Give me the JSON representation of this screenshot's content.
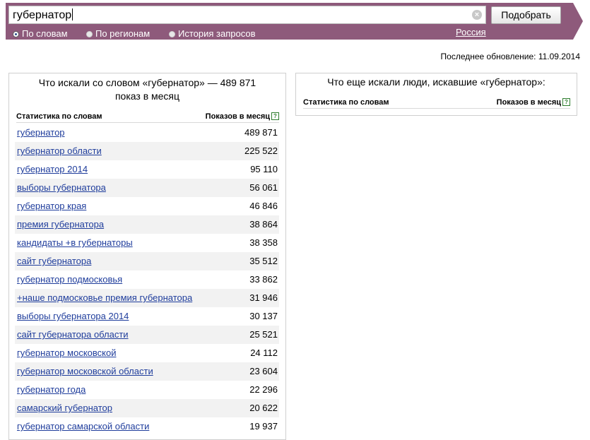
{
  "search": {
    "query": "губернатор",
    "submit_label": "Подобрать",
    "clear_symbol": "×"
  },
  "modes": [
    {
      "label": "По словам",
      "checked": true
    },
    {
      "label": "По регионам",
      "checked": false
    },
    {
      "label": "История запросов",
      "checked": false
    }
  ],
  "region": "Россия",
  "updated": "Последнее обновление: 11.09.2014",
  "left_panel": {
    "title_line1": "Что искали со словом «губернатор» — 489 871",
    "title_line2": "показ в месяц",
    "col_words": "Статистика по словам",
    "col_shows": "Показов в месяц",
    "help_symbol": "?",
    "rows": [
      {
        "kw": "губернатор",
        "count": "489 871"
      },
      {
        "kw": "губернатор области",
        "count": "225 522"
      },
      {
        "kw": "губернатор 2014",
        "count": "95 110"
      },
      {
        "kw": "выборы губернатора",
        "count": "56 061"
      },
      {
        "kw": "губернатор края",
        "count": "46 846"
      },
      {
        "kw": "премия губернатора",
        "count": "38 864"
      },
      {
        "kw": "кандидаты +в губернаторы",
        "count": "38 358"
      },
      {
        "kw": "сайт губернатора",
        "count": "35 512"
      },
      {
        "kw": "губернатор подмосковья",
        "count": "33 862"
      },
      {
        "kw": "+наше подмосковье премия губернатора",
        "count": "31 946"
      },
      {
        "kw": "выборы губернатора 2014",
        "count": "30 137"
      },
      {
        "kw": "сайт губернатора области",
        "count": "25 521"
      },
      {
        "kw": "губернатор московской",
        "count": "24 112"
      },
      {
        "kw": "губернатор московской области",
        "count": "23 604"
      },
      {
        "kw": "губернатор года",
        "count": "22 296"
      },
      {
        "kw": "самарский губернатор",
        "count": "20 622"
      },
      {
        "kw": "губернатор самарской области",
        "count": "19 937"
      }
    ]
  },
  "right_panel": {
    "title": "Что еще искали люди, искавшие «губернатор»:",
    "col_words": "Статистика по словам",
    "col_shows": "Показов в месяц",
    "help_symbol": "?"
  },
  "colors": {
    "band": "#8e5a7b",
    "link": "#1f3d9c",
    "stripe": "#f2f2f2"
  }
}
